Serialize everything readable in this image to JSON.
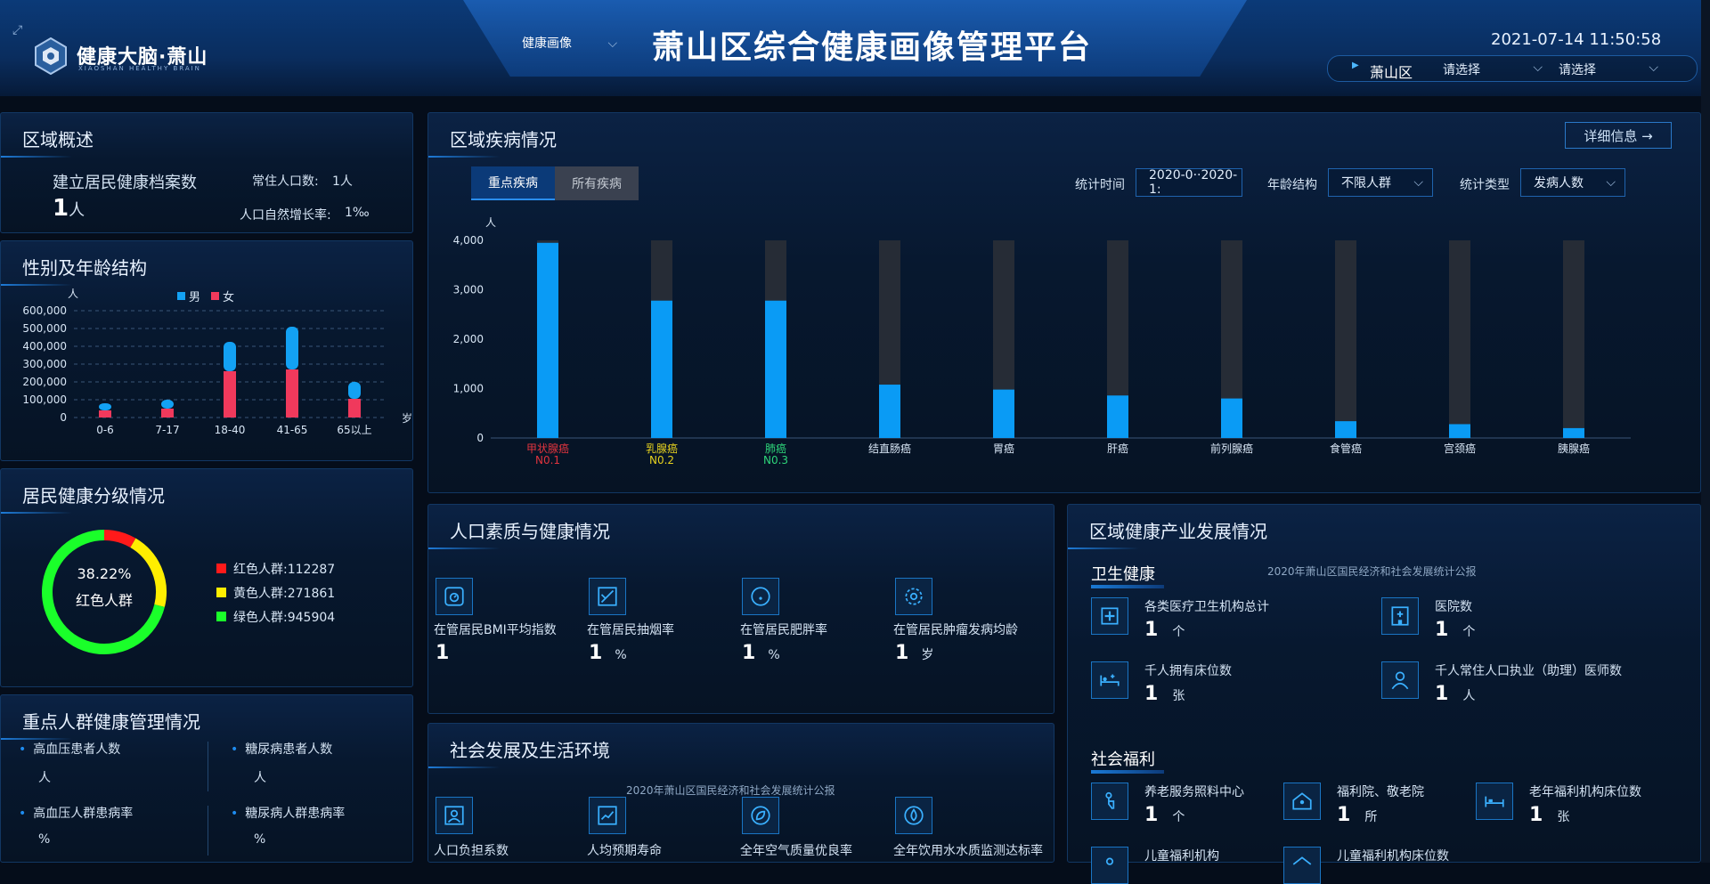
{
  "header": {
    "brand": "健康大脑·萧山",
    "brand_sub": "XIAOSHAN HEALTHY BRAIN",
    "nav_label": "健康画像",
    "title": "萧山区综合健康画像管理平台",
    "datetime": "2021-07-14 11:50:58",
    "region": "萧山区",
    "select1": "请选择",
    "select2": "请选择"
  },
  "overview": {
    "title": "区域概述",
    "records_label": "建立居民健康档案数",
    "records_value": "1",
    "records_unit": "人",
    "population_label": "常住人口数:",
    "population_value": "1人",
    "growth_label": "人口自然增长率:",
    "growth_value": "1‰"
  },
  "gender_age": {
    "title": "性别及年龄结构",
    "legend_male": "男",
    "legend_female": "女",
    "y_unit": "人",
    "x_unit": "岁",
    "chart_data": {
      "type": "bar",
      "categories": [
        "0-6",
        "7-17",
        "18-40",
        "41-65",
        "65以上"
      ],
      "y_ticks": [
        "600,000",
        "500,000",
        "400,000",
        "300,000",
        "200,000",
        "100,000",
        "0"
      ],
      "ylim": [
        0,
        600000
      ],
      "series": [
        {
          "name": "女",
          "values": [
            40000,
            50000,
            260000,
            270000,
            105000
          ],
          "color": "#f0395c"
        },
        {
          "name": "男",
          "values": [
            40000,
            50000,
            165000,
            240000,
            95000
          ],
          "color": "#13a1f3"
        }
      ],
      "stacked": true
    }
  },
  "health_grade": {
    "title": "居民健康分级情况",
    "center_pct": "38.22%",
    "center_label": "红色人群",
    "legend": [
      {
        "label": "红色人群:112287",
        "color": "#ff1a1a",
        "value": 112287
      },
      {
        "label": "黄色人群:271861",
        "color": "#ffee00",
        "value": 271861
      },
      {
        "label": "绿色人群:945904",
        "color": "#1aff2a",
        "value": 945904
      }
    ]
  },
  "key_groups": {
    "title": "重点人群健康管理情况",
    "items": [
      {
        "label": "高血压患者人数",
        "value": "人"
      },
      {
        "label": "糖尿病患者人数",
        "value": "人"
      },
      {
        "label": "高血压人群患病率",
        "value": "%"
      },
      {
        "label": "糖尿病人群患病率",
        "value": "%"
      }
    ]
  },
  "disease": {
    "title": "区域疾病情况",
    "detail_button": "详细信息 →",
    "tab_key": "重点疾病",
    "tab_all": "所有疾病",
    "time_label": "统计时间",
    "time_value": "2020-0··2020-1:",
    "age_label": "年龄结构",
    "age_value": "不限人群",
    "type_label": "统计类型",
    "type_value": "发病人数",
    "y_unit": "人",
    "chart_data": {
      "type": "bar",
      "categories": [
        "甲状腺癌",
        "乳腺癌",
        "肺癌",
        "结直肠癌",
        "胃癌",
        "肝癌",
        "前列腺癌",
        "食管癌",
        "宫颈癌",
        "胰腺癌"
      ],
      "ranks": [
        "N0.1",
        "N0.2",
        "N0.3",
        "",
        "",
        "",
        "",
        "",
        "",
        ""
      ],
      "rank_colors": [
        "#e0343e",
        "#e6d21f",
        "#2ed67a",
        "#d8e6f5",
        "#d8e6f5",
        "#d8e6f5",
        "#d8e6f5",
        "#d8e6f5",
        "#d8e6f5",
        "#d8e6f5"
      ],
      "values": [
        3950,
        2780,
        2780,
        1080,
        980,
        860,
        800,
        340,
        280,
        200
      ],
      "max_background": 4000,
      "y_ticks": [
        "4,000",
        "3,000",
        "2,000",
        "1,000",
        "0"
      ],
      "ylim": [
        0,
        4000
      ]
    }
  },
  "population": {
    "title": "人口素质与健康情况",
    "items": [
      {
        "label": "在管居民BMI平均指数",
        "value": "1",
        "unit": ""
      },
      {
        "label": "在管居民抽烟率",
        "value": "1",
        "unit": "%"
      },
      {
        "label": "在管居民肥胖率",
        "value": "1",
        "unit": "%"
      },
      {
        "label": "在管居民肿瘤发病均龄",
        "value": "1",
        "unit": "岁"
      }
    ]
  },
  "social": {
    "title": "社会发展及生活环境",
    "source": "2020年萧山区国民经济和社会发展统计公报",
    "items": [
      {
        "label": "人口负担系数"
      },
      {
        "label": "人均预期寿命"
      },
      {
        "label": "全年空气质量优良率"
      },
      {
        "label": "全年饮用水水质监测达标率"
      }
    ]
  },
  "industry": {
    "title": "区域健康产业发展情况",
    "health_title": "卫生健康",
    "source": "2020年萧山区国民经济和社会发展统计公报",
    "health_items": [
      {
        "label": "各类医疗卫生机构总计",
        "value": "1",
        "unit": "个"
      },
      {
        "label": "医院数",
        "value": "1",
        "unit": "个"
      },
      {
        "label": "千人拥有床位数",
        "value": "1",
        "unit": "张"
      },
      {
        "label": "千人常住人口执业（助理）医师数",
        "value": "1",
        "unit": "人"
      }
    ],
    "welfare_title": "社会福利",
    "welfare_items": [
      {
        "label": "养老服务照料中心",
        "value": "1",
        "unit": "个"
      },
      {
        "label": "福利院、敬老院",
        "value": "1",
        "unit": "所"
      },
      {
        "label": "老年福利机构床位数",
        "value": "1",
        "unit": "张"
      },
      {
        "label": "儿童福利机构",
        "value": "",
        "unit": ""
      },
      {
        "label": "儿童福利机构床位数",
        "value": "",
        "unit": ""
      }
    ]
  }
}
